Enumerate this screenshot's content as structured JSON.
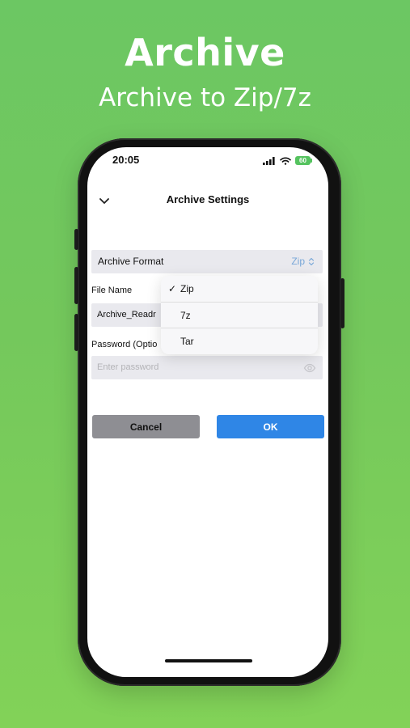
{
  "promo": {
    "title": "Archive",
    "subtitle": "Archive to Zip/7z"
  },
  "status_bar": {
    "time": "20:05",
    "battery": "60"
  },
  "screen": {
    "title": "Archive Settings"
  },
  "archive_format": {
    "label": "Archive Format",
    "selected": "Zip"
  },
  "file_name": {
    "label": "File Name",
    "value": "Archive_Readr"
  },
  "password": {
    "label": "Password (Optio",
    "placeholder": "Enter password"
  },
  "dropdown": {
    "check": "✓",
    "options": [
      {
        "label": "Zip"
      },
      {
        "label": "7z"
      },
      {
        "label": "Tar"
      }
    ]
  },
  "buttons": {
    "cancel_label": "Cancel",
    "ok_label": "OK"
  },
  "colors": {
    "background": "#6cc763",
    "accent": "#2f86e6",
    "secondary_button": "#8e8e93",
    "battery": "#55c35f"
  },
  "icons": {
    "back": "chevron-down-icon",
    "selector": "up-down-chevron-icon",
    "signal": "cellular-signal-icon",
    "wifi": "wifi-icon",
    "battery": "battery-icon",
    "eye": "eye-icon",
    "check": "checkmark-icon"
  }
}
